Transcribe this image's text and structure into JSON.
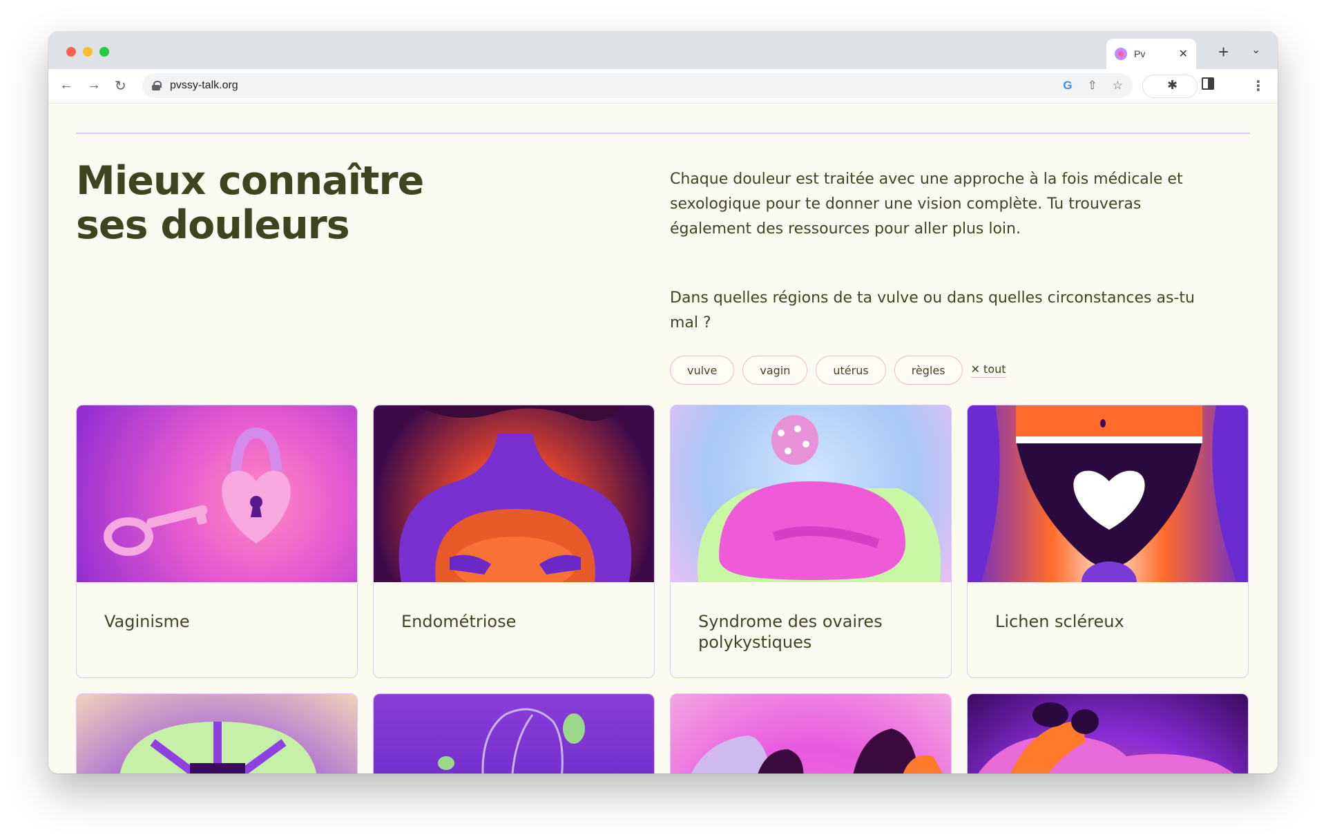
{
  "browser": {
    "tab_title": "Pv",
    "tab_close": "✕",
    "new_tab": "+",
    "tab_menu": "⌄",
    "url": "pvssy-talk.org",
    "icons": [
      "back-arrow-icon",
      "forward-arrow-icon",
      "reload-icon",
      "lock-icon",
      "google-icon",
      "share-icon",
      "star-icon",
      "extensions-icon",
      "side-panel-icon",
      "kebab-menu-icon"
    ]
  },
  "section": {
    "title_line1": "Mieux connaître",
    "title_line2": "ses douleurs",
    "intro": "Chaque douleur est traitée avec une approche à la fois médicale et sexologique pour te donner une vision complète. Tu trouveras également des ressources pour aller plus loin.",
    "question": "Dans quelles régions de ta vulve ou dans quelles circonstances as-tu mal ?"
  },
  "filters": {
    "chips": [
      "vulve",
      "vagin",
      "utérus",
      "règles"
    ],
    "clear_label": "✕ tout"
  },
  "cards": [
    {
      "title": "Vaginisme"
    },
    {
      "title": "Endométriose"
    },
    {
      "title": "Syndrome des ovaires polykystiques"
    },
    {
      "title": "Lichen scléreux"
    }
  ],
  "colors": {
    "text": "#3f4420",
    "background": "#fbfbf2",
    "card_border": "#d9c9f6",
    "chip_border": "#f2b6c8"
  }
}
